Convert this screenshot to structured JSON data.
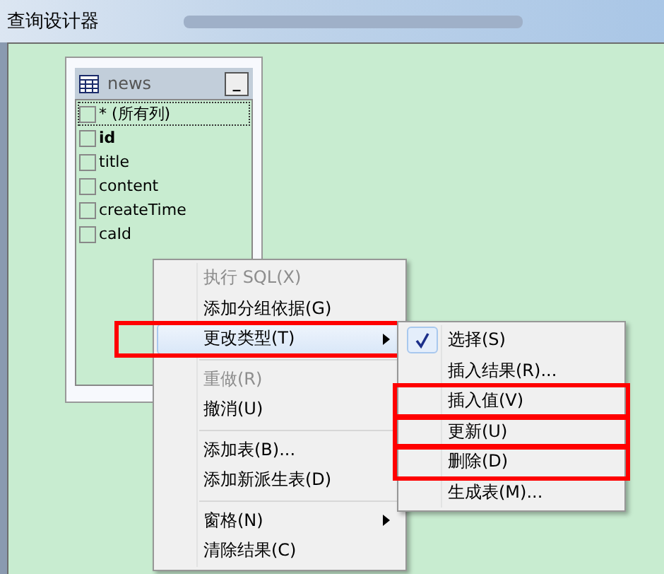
{
  "window": {
    "title": "查询设计器"
  },
  "table_card": {
    "title": "news",
    "minimize": "_",
    "columns": [
      {
        "name": "* (所有列)",
        "checked": false,
        "focused": true,
        "bold": false
      },
      {
        "name": "id",
        "checked": false,
        "focused": false,
        "bold": true
      },
      {
        "name": "title",
        "checked": false,
        "focused": false,
        "bold": false
      },
      {
        "name": "content",
        "checked": false,
        "focused": false,
        "bold": false
      },
      {
        "name": "createTime",
        "checked": false,
        "focused": false,
        "bold": false
      },
      {
        "name": "caId",
        "checked": false,
        "focused": false,
        "bold": false
      }
    ]
  },
  "context_menu": {
    "items": [
      {
        "kind": "item",
        "label": "执行 SQL(X)",
        "disabled": true,
        "submenu": false,
        "hovered": false,
        "highlighted": false
      },
      {
        "kind": "item",
        "label": "添加分组依据(G)",
        "disabled": false,
        "submenu": false,
        "hovered": false,
        "highlighted": false
      },
      {
        "kind": "item",
        "label": "更改类型(T)",
        "disabled": false,
        "submenu": true,
        "hovered": true,
        "highlighted": true
      },
      {
        "kind": "separator"
      },
      {
        "kind": "item",
        "label": "重做(R)",
        "disabled": true,
        "submenu": false,
        "hovered": false,
        "highlighted": false
      },
      {
        "kind": "item",
        "label": "撤消(U)",
        "disabled": false,
        "submenu": false,
        "hovered": false,
        "highlighted": false
      },
      {
        "kind": "separator"
      },
      {
        "kind": "item",
        "label": "添加表(B)...",
        "disabled": false,
        "submenu": false,
        "hovered": false,
        "highlighted": false
      },
      {
        "kind": "item",
        "label": "添加新派生表(D)",
        "disabled": false,
        "submenu": false,
        "hovered": false,
        "highlighted": false
      },
      {
        "kind": "separator"
      },
      {
        "kind": "item",
        "label": "窗格(N)",
        "disabled": false,
        "submenu": true,
        "hovered": false,
        "highlighted": false
      },
      {
        "kind": "item",
        "label": "清除结果(C)",
        "disabled": false,
        "submenu": false,
        "hovered": false,
        "highlighted": false
      }
    ]
  },
  "submenu": {
    "items": [
      {
        "label": "选择(S)",
        "checked": true,
        "highlighted": false
      },
      {
        "label": "插入结果(R)...",
        "checked": false,
        "highlighted": false
      },
      {
        "label": "插入值(V)",
        "checked": false,
        "highlighted": true
      },
      {
        "label": "更新(U)",
        "checked": false,
        "highlighted": true
      },
      {
        "label": "删除(D)",
        "checked": false,
        "highlighted": true
      },
      {
        "label": "生成表(M)...",
        "checked": false,
        "highlighted": false
      }
    ]
  }
}
